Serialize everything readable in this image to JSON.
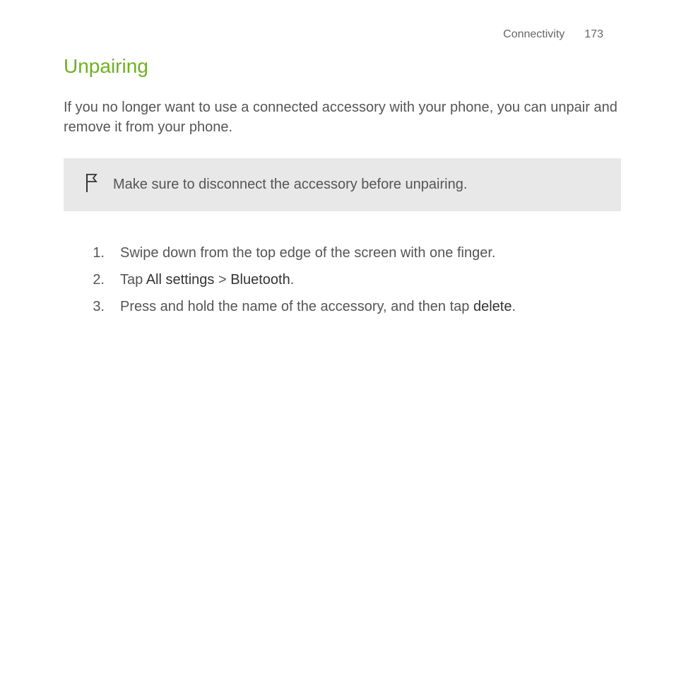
{
  "header": {
    "chapter": "Connectivity",
    "page_number": "173"
  },
  "section_title": "Unpairing",
  "intro": "If you no longer want to use a connected accessory with your phone, you can unpair and remove it from your phone.",
  "note": "Make sure to disconnect the accessory before unpairing.",
  "steps": [
    {
      "number": "1.",
      "prefix": "Swipe down from the top edge of the screen with one finger.",
      "bold1": "",
      "mid": "",
      "bold2": "",
      "suffix": ""
    },
    {
      "number": "2.",
      "prefix": "Tap ",
      "bold1": "All settings",
      "mid": " > ",
      "bold2": "Bluetooth",
      "suffix": "."
    },
    {
      "number": "3.",
      "prefix": "Press and hold the name of the accessory, and then tap ",
      "bold1": "delete",
      "mid": "",
      "bold2": "",
      "suffix": "."
    }
  ]
}
